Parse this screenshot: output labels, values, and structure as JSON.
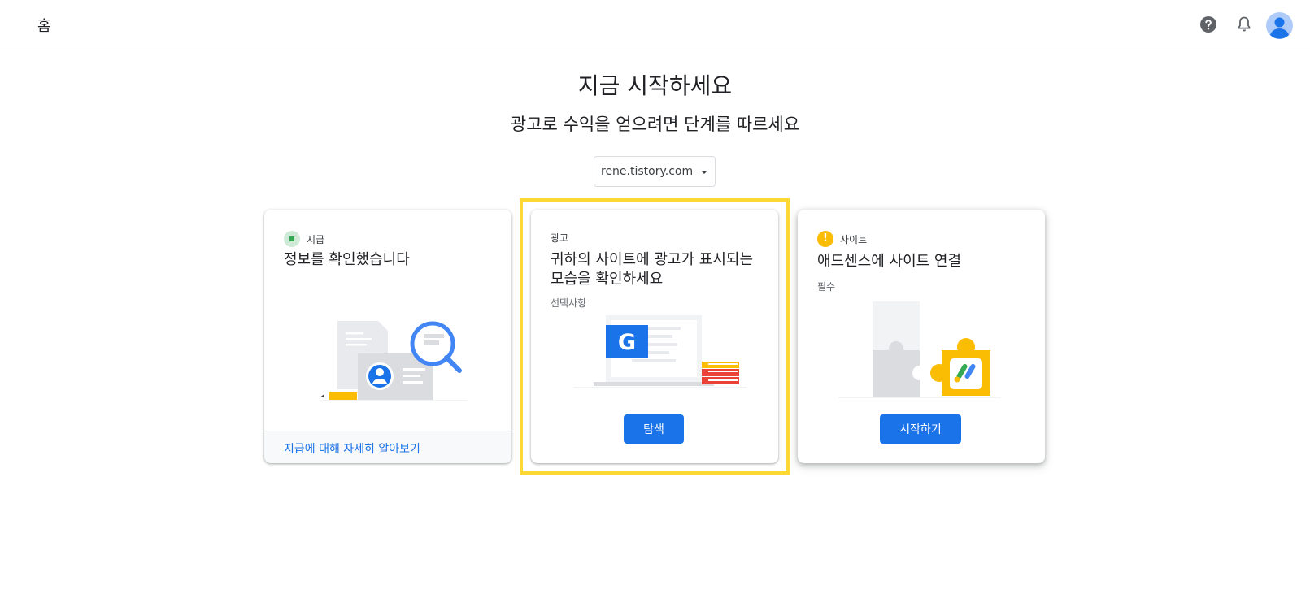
{
  "header": {
    "title": "홈"
  },
  "main": {
    "heading": "지금 시작하세요",
    "subheading": "광고로 수익을 얻으려면 단계를 따르세요",
    "site_selector": {
      "value": "rene.tistory.com"
    }
  },
  "cards": [
    {
      "tag": "지급",
      "title": "정보를 확인했습니다",
      "footer_link": "지급에 대해 자세히 알아보기"
    },
    {
      "tag": "광고",
      "title": "귀하의 사이트에 광고가 표시되는 모습을 확인하세요",
      "subtitle": "선택사항",
      "button": "탐색"
    },
    {
      "tag": "사이트",
      "title": "애드센스에 사이트 연결",
      "subtitle": "필수",
      "button": "시작하기"
    }
  ],
  "colors": {
    "accent": "#1a73e8",
    "highlight": "#fdd835",
    "status_done": "#34a853",
    "status_warning": "#fbbc04"
  },
  "icons": [
    "help-icon",
    "bell-icon",
    "avatar-icon",
    "status-done-icon",
    "warning-icon"
  ]
}
